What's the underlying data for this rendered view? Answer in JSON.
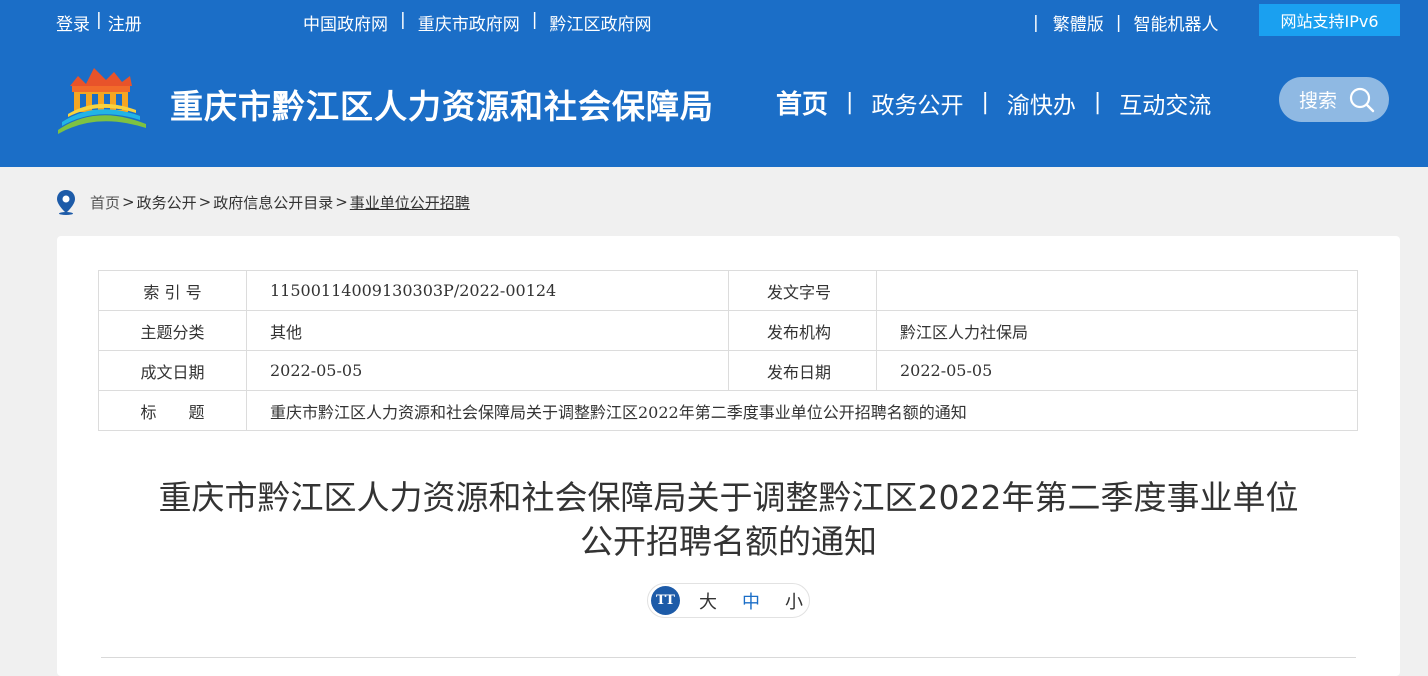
{
  "topbar": {
    "login": "登录",
    "divider": "|",
    "register": "注册",
    "links": [
      "中国政府网",
      "重庆市政府网",
      "黔江区政府网"
    ],
    "right_links": [
      "繁體版",
      "智能机器人"
    ],
    "ipv6": "网站支持IPv6"
  },
  "header": {
    "site_title": "重庆市黔江区人力资源和社会保障局"
  },
  "nav": {
    "items": [
      "首页",
      "政务公开",
      "渝快办",
      "互动交流"
    ],
    "search_label": "搜索"
  },
  "breadcrumb": {
    "items": [
      "首页",
      "政务公开",
      "政府信息公开目录",
      "事业单位公开招聘"
    ],
    "separator": ">"
  },
  "meta": {
    "index_label": "索 引 号",
    "index_value": "11500114009130303P/2022-00124",
    "docno_label": "发文字号",
    "docno_value": "",
    "topic_label": "主题分类",
    "topic_value": "其他",
    "publisher_label": "发布机构",
    "publisher_value": "黔江区人力社保局",
    "written_label": "成文日期",
    "written_value": "2022-05-05",
    "published_label": "发布日期",
    "published_value": "2022-05-05",
    "title_label": "标　　题",
    "title_value": "重庆市黔江区人力资源和社会保障局关于调整黔江区2022年第二季度事业单位公开招聘名额的通知"
  },
  "article": {
    "title_line1": "重庆市黔江区人力资源和社会保障局关于调整黔江区2022年第二季度事业单位",
    "title_line2": "公开招聘名额的通知"
  },
  "fontsize": {
    "icon_text": "TT",
    "options": [
      "大",
      "中",
      "小"
    ],
    "selected": "中"
  },
  "colors": {
    "header_bg": "#1b6ec7",
    "ipv6_bg": "#1aa0f0",
    "accent": "#1d5ba8"
  }
}
